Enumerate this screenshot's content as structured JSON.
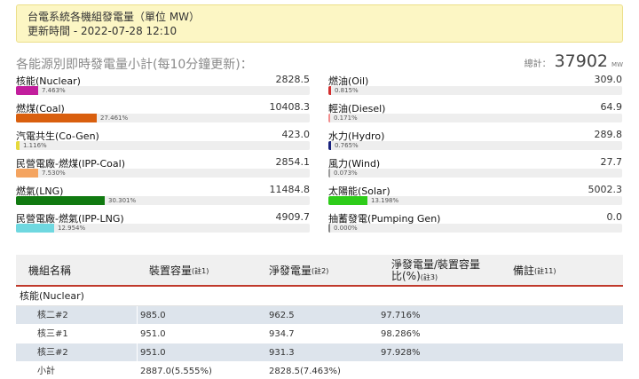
{
  "header": {
    "title": "台電系統各機組發電量（單位 MW）",
    "updated": "更新時間 - 2022-07-28 12:10"
  },
  "summary": {
    "heading": "各能源別即時發電量小計(每10分鐘更新)：",
    "total_label": "總計：",
    "total_value": "37902",
    "total_unit": "MW"
  },
  "sources_left": [
    {
      "name": "核能(Nuclear)",
      "value": "2828.5",
      "percent": "7.463%",
      "fraction": 0.07463,
      "color": "#c21e9d"
    },
    {
      "name": "燃煤(Coal)",
      "value": "10408.3",
      "percent": "27.461%",
      "fraction": 0.27461,
      "color": "#d95f0e"
    },
    {
      "name": "汽電共生(Co-Gen)",
      "value": "423.0",
      "percent": "1.116%",
      "fraction": 0.01116,
      "color": "#e6d93b"
    },
    {
      "name": "民營電廠-燃煤(IPP-Coal)",
      "value": "2854.1",
      "percent": "7.530%",
      "fraction": 0.0753,
      "color": "#f4a460"
    },
    {
      "name": "燃氣(LNG)",
      "value": "11484.8",
      "percent": "30.301%",
      "fraction": 0.30301,
      "color": "#117a11"
    },
    {
      "name": "民營電廠-燃氣(IPP-LNG)",
      "value": "4909.7",
      "percent": "12.954%",
      "fraction": 0.12954,
      "color": "#6fd8e0"
    }
  ],
  "sources_right": [
    {
      "name": "燃油(Oil)",
      "value": "309.0",
      "percent": "0.815%",
      "fraction": 0.00815,
      "color": "#d32f2f"
    },
    {
      "name": "輕油(Diesel)",
      "value": "64.9",
      "percent": "0.171%",
      "fraction": 0.00171,
      "color": "#f28e8e"
    },
    {
      "name": "水力(Hydro)",
      "value": "289.8",
      "percent": "0.765%",
      "fraction": 0.00765,
      "color": "#1a237e"
    },
    {
      "name": "風力(Wind)",
      "value": "27.7",
      "percent": "0.073%",
      "fraction": 0.00073,
      "color": "#9e9e9e"
    },
    {
      "name": "太陽能(Solar)",
      "value": "5002.3",
      "percent": "13.198%",
      "fraction": 0.13198,
      "color": "#2ecc1a"
    },
    {
      "name": "抽蓄發電(Pumping Gen)",
      "value": "0.0",
      "percent": "0.000%",
      "fraction": 0.0,
      "color": "#888888"
    }
  ],
  "table": {
    "headers": {
      "unit_name": "機組名稱",
      "capacity": "裝置容量",
      "capacity_note": "(註1)",
      "net_gen": "淨發電量",
      "net_gen_note": "(註2)",
      "ratio_line1": "淨發電量/裝置容量",
      "ratio_line2": "比(%)",
      "ratio_note": "(註3)",
      "remark": "備註",
      "remark_note": "(註11)"
    },
    "group": "核能(Nuclear)",
    "rows": [
      {
        "name": "核二#2",
        "capacity": "985.0",
        "net": "962.5",
        "ratio": "97.716%"
      },
      {
        "name": "核三#1",
        "capacity": "951.0",
        "net": "934.7",
        "ratio": "98.286%"
      },
      {
        "name": "核三#2",
        "capacity": "951.0",
        "net": "931.3",
        "ratio": "97.928%"
      },
      {
        "name": "小計",
        "capacity": "2887.0(5.555%)",
        "net": "2828.5(7.463%)",
        "ratio": ""
      }
    ]
  }
}
